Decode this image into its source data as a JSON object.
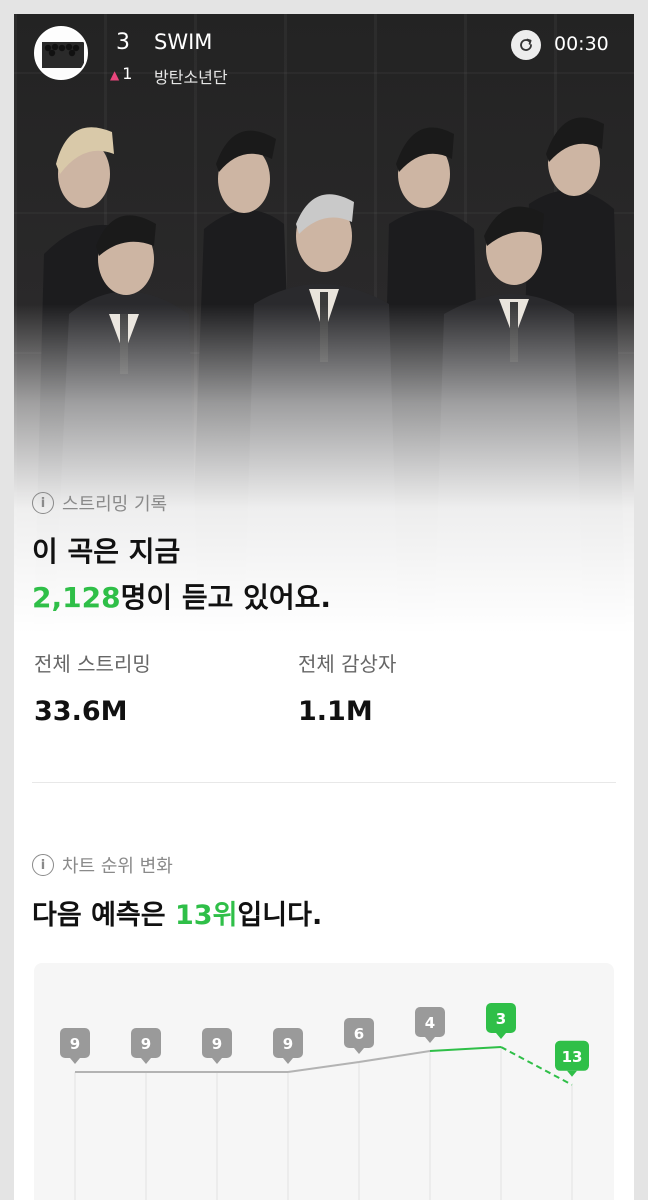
{
  "header": {
    "rank": "3",
    "rank_change": "1",
    "song_title": "SWIM",
    "artist": "방탄소년단",
    "time": "00:30"
  },
  "streaming": {
    "section_label": "스트리밍 기록",
    "line1": "이 곡은 지금",
    "listeners": "2,128",
    "line2_suffix": "명이 듣고 있어요.",
    "total_streams_label": "전체 스트리밍",
    "total_streams": "33.6M",
    "total_listeners_label": "전체 감상자",
    "total_listeners": "1.1M"
  },
  "rank_chart": {
    "section_label": "차트 순위 변화",
    "prediction_prefix": "다음 예측은 ",
    "prediction_value": "13위",
    "prediction_suffix": "입니다."
  },
  "colors": {
    "accent_green": "#2fbf48",
    "rank_up_pink": "#e8467c"
  },
  "chart_data": {
    "type": "line",
    "x": [
      1,
      2,
      3,
      4,
      5,
      6,
      7,
      8
    ],
    "values": [
      9,
      9,
      9,
      9,
      6,
      4,
      3,
      13
    ],
    "labels": [
      "9",
      "9",
      "9",
      "9",
      "6",
      "4",
      "3",
      "13"
    ],
    "highlighted": [
      false,
      false,
      false,
      false,
      false,
      false,
      true,
      true
    ],
    "predicted": [
      false,
      false,
      false,
      false,
      false,
      false,
      false,
      true
    ],
    "title": "",
    "xlabel": "",
    "ylabel": "",
    "grid": true
  }
}
